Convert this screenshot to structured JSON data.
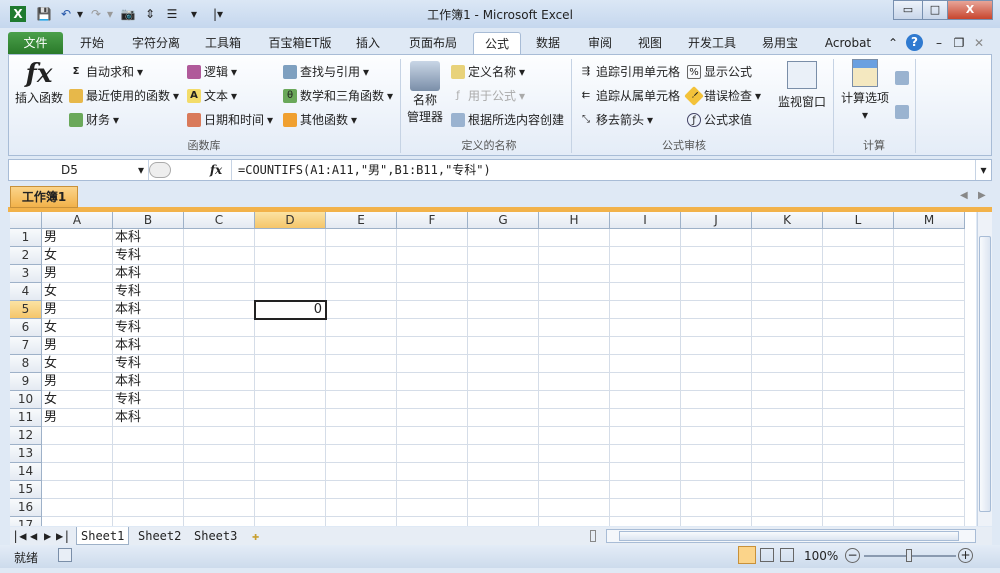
{
  "window": {
    "title": "工作簿1 - Microsoft Excel",
    "minimize": "▭",
    "maximize": "□",
    "close": "X"
  },
  "quick_access": [
    "X",
    "💾",
    "↶",
    "▾",
    "↷",
    "▾",
    "📷",
    "⇕",
    "☰",
    "▾",
    "|▾"
  ],
  "tabs": [
    {
      "label": "文件"
    },
    {
      "label": "开始"
    },
    {
      "label": "字符分离"
    },
    {
      "label": "工具箱"
    },
    {
      "label": "百宝箱ET版"
    },
    {
      "label": "插入"
    },
    {
      "label": "页面布局"
    },
    {
      "label": "公式"
    },
    {
      "label": "数据"
    },
    {
      "label": "审阅"
    },
    {
      "label": "视图"
    },
    {
      "label": "开发工具"
    },
    {
      "label": "易用宝"
    },
    {
      "label": "Acrobat"
    }
  ],
  "ribbon_icons": {
    "collapse": "⌃",
    "help": "?",
    "min": "–",
    "restore": "❐",
    "close": "✕"
  },
  "ribbon": {
    "insert_function": "插入函数",
    "fx": "fx",
    "autosum": "自动求和",
    "recent": "最近使用的函数",
    "finance": "财务",
    "logic": "逻辑",
    "text": "文本",
    "datetime": "日期和时间",
    "lookup": "查找与引用",
    "math": "数学和三角函数",
    "other": "其他函数",
    "group_library": "函数库",
    "name_manager_1": "名称",
    "name_manager_2": "管理器",
    "define_name": "定义名称",
    "use_in_formula": "用于公式",
    "create_from_sel": "根据所选内容创建",
    "group_names": "定义的名称",
    "trace_precedents": "追踪引用单元格",
    "trace_dependents": "追踪从属单元格",
    "remove_arrows": "移去箭头",
    "show_formulas": "显示公式",
    "error_check": "错误检查",
    "evaluate": "公式求值",
    "watch": "监视窗口",
    "group_audit": "公式审核",
    "calc_options": "计算选项",
    "group_calc": "计算"
  },
  "formula_bar": {
    "name_box": "D5",
    "fx": "fx",
    "formula": "=COUNTIFS(A1:A11,\"男\",B1:B11,\"专科\")"
  },
  "workbook_tab": "工作簿1",
  "columns": [
    "A",
    "B",
    "C",
    "D",
    "E",
    "F",
    "G",
    "H",
    "I",
    "J",
    "K",
    "L",
    "M"
  ],
  "rows": [
    "1",
    "2",
    "3",
    "4",
    "5",
    "6",
    "7",
    "8",
    "9",
    "10",
    "11",
    "12",
    "13",
    "14",
    "15",
    "16",
    "17"
  ],
  "cells": {
    "A": [
      "男",
      "女",
      "男",
      "女",
      "男",
      "女",
      "男",
      "女",
      "男",
      "女",
      "男"
    ],
    "B": [
      "本科",
      "专科",
      "本科",
      "专科",
      "本科",
      "专科",
      "本科",
      "专科",
      "本科",
      "专科",
      "本科"
    ],
    "D5": "0"
  },
  "selected": {
    "col": "D",
    "row": "5"
  },
  "sheets": [
    "Sheet1",
    "Sheet2",
    "Sheet3"
  ],
  "sheet_nav": [
    "|◀",
    "◀",
    "▶",
    "▶|"
  ],
  "status": {
    "ready": "就绪",
    "zoom": "100%",
    "zoom_out": "−",
    "zoom_in": "+"
  }
}
